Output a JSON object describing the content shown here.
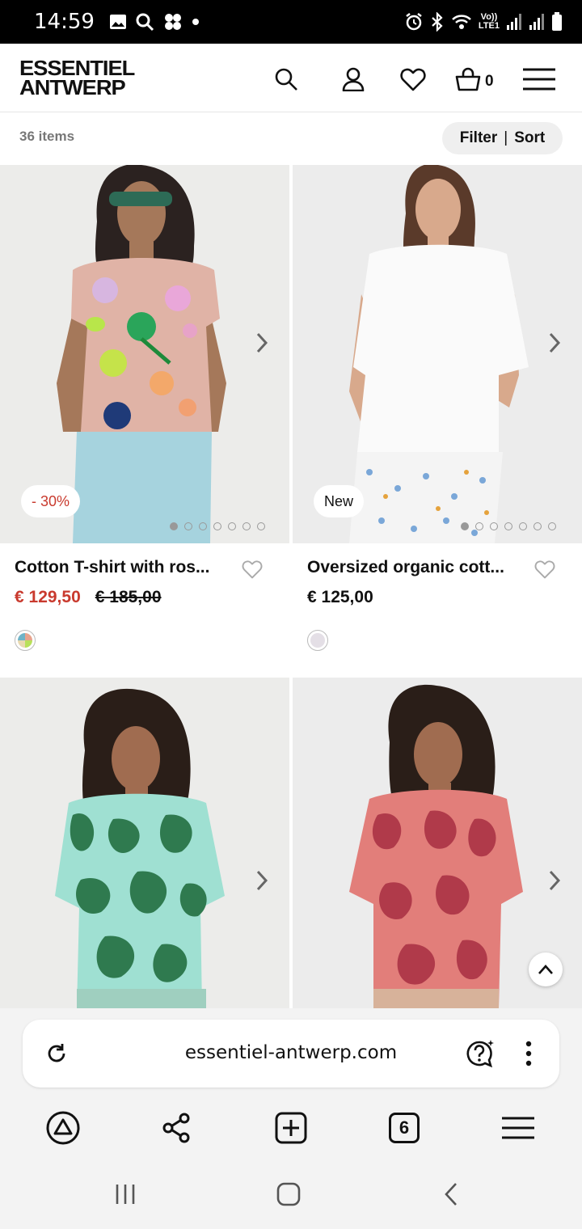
{
  "status_bar": {
    "time": "14:59",
    "network_label_top": "Vo))",
    "network_label_bottom": "LTE1"
  },
  "header": {
    "logo_line1": "ESSENTIEL",
    "logo_line2": "ANTWERP",
    "cart_count": "0"
  },
  "listing": {
    "item_count": "36 items",
    "filter_label": "Filter",
    "separator": "|",
    "sort_label": "Sort"
  },
  "products": [
    {
      "name": "Cotton T-shirt with ros...",
      "price": "€ 129,50",
      "old_price": "€ 185,00",
      "badge": "- 30%",
      "image_dots": 7,
      "active_dot": 0,
      "swatch_color": "#e9d9b0"
    },
    {
      "name": "Oversized organic cott...",
      "price": "€ 125,00",
      "badge": "New",
      "image_dots": 7,
      "active_dot": 0,
      "swatch_color": "#e4dfe6"
    },
    {
      "name": "",
      "price": ""
    },
    {
      "name": "",
      "price": ""
    }
  ],
  "browser": {
    "url": "essentiel-antwerp.com",
    "tabs_count": "6"
  },
  "colors": {
    "sale": "#c93a2e",
    "pill_bg": "#efefef",
    "muted_text": "#777777"
  }
}
